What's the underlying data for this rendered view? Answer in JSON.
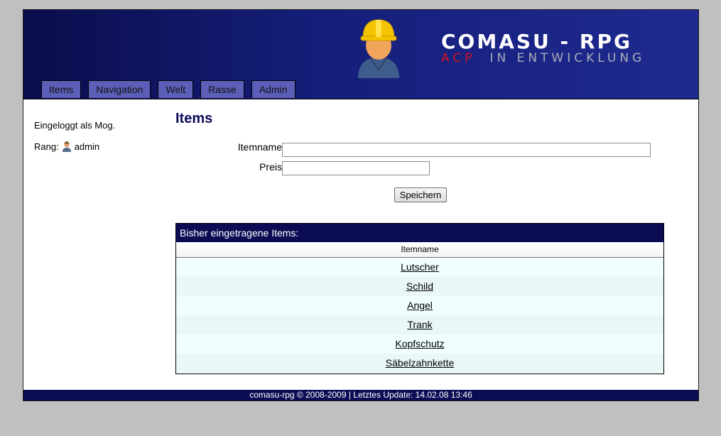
{
  "header": {
    "logo_title": "comasu - rpg",
    "logo_acp": "ACP",
    "logo_dev": "in Entwicklung",
    "brand_color": "#151f7a",
    "accent_red": "#d4111b"
  },
  "nav": {
    "tabs": [
      "Items",
      "Navigation",
      "Welt",
      "Rasse",
      "Admin"
    ]
  },
  "sidebar": {
    "login_text": "Eingeloggt als Mog.",
    "rank_label": "Rang:",
    "rank_icon": "admin-user-icon",
    "rank_value": "admin"
  },
  "main": {
    "title": "Items",
    "form": {
      "itemname_label": "Itemname",
      "itemname_value": "",
      "preis_label": "Preis",
      "preis_value": "",
      "save_label": "Speichern"
    },
    "table": {
      "heading": "Bisher eingetragene Items:",
      "column_header": "Itemname",
      "rows": [
        "Lutscher",
        "Schild",
        "Angel",
        "Trank",
        "Kopfschutz",
        "Säbelzahnkette"
      ]
    }
  },
  "footer": {
    "text": "comasu-rpg © 2008-2009 | Letztes Update: 14.02.08 13:46"
  }
}
